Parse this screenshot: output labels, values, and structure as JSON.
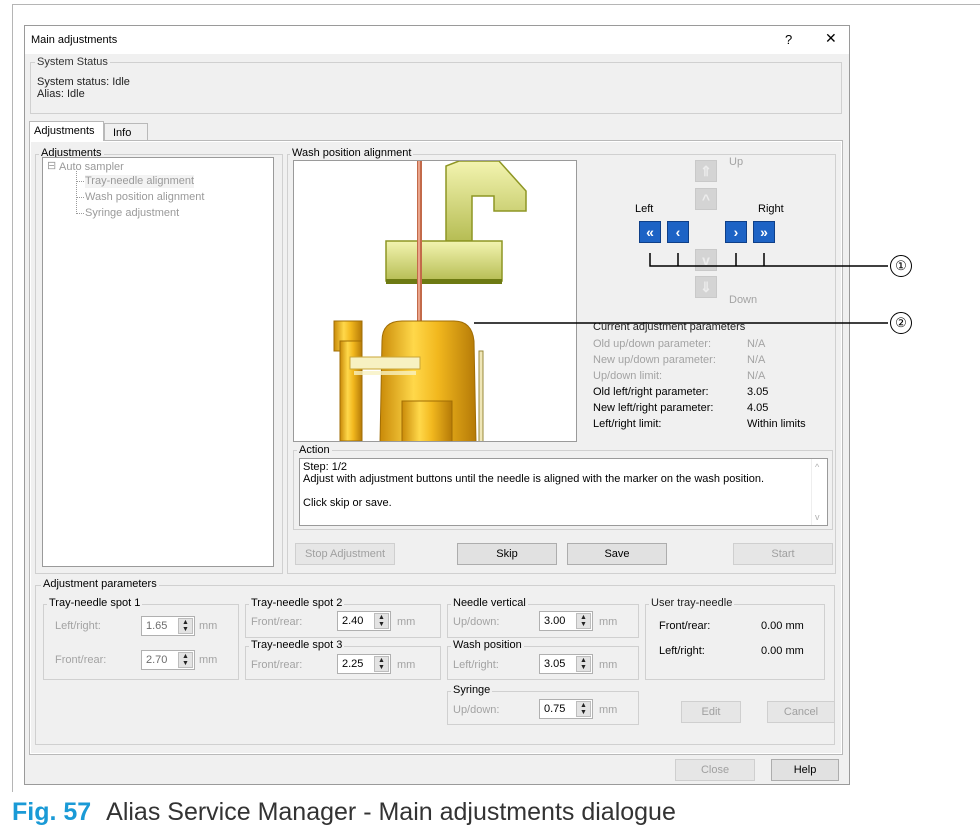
{
  "window": {
    "title": "Main adjustments",
    "help": "?",
    "close": "✕"
  },
  "system_status": {
    "group": "System Status",
    "status": "System status: Idle",
    "alias": "Alias: Idle"
  },
  "tabs": [
    "Adjustments",
    "Info"
  ],
  "adjustments_tree": {
    "group": "Adjustments",
    "root": "Auto sampler",
    "root_toggle": "⊟",
    "children": [
      "Tray-needle alignment",
      "Wash position alignment",
      "Syringe adjustment"
    ]
  },
  "wash": {
    "group": "Wash position alignment",
    "up": "Up",
    "down": "Down",
    "left": "Left",
    "right": "Right",
    "callouts": [
      "①",
      "②"
    ]
  },
  "params": {
    "title": "Current adjustment parameters",
    "rows": [
      {
        "label": "Old up/down parameter:",
        "value": "N/A",
        "enabled": false
      },
      {
        "label": "New up/down parameter:",
        "value": "N/A",
        "enabled": false
      },
      {
        "label": "Up/down limit:",
        "value": "N/A",
        "enabled": false
      },
      {
        "label": "Old left/right parameter:",
        "value": "3.05",
        "enabled": true
      },
      {
        "label": "New left/right parameter:",
        "value": "4.05",
        "enabled": true
      },
      {
        "label": "Left/right limit:",
        "value": "Within limits",
        "enabled": true
      }
    ]
  },
  "action": {
    "group": "Action",
    "step": "Step: 1/2",
    "text": "Adjust with adjustment buttons until the needle is aligned with the marker on the wash position.",
    "hint": "Click skip or save."
  },
  "buttons": {
    "stop": "Stop Adjustment",
    "skip": "Skip",
    "save": "Save",
    "start": "Start",
    "edit": "Edit",
    "cancel": "Cancel",
    "close": "Close",
    "help": "Help"
  },
  "adj_params": {
    "group": "Adjustment parameters",
    "spot1": {
      "title": "Tray-needle spot 1",
      "lr_label": "Left/right:",
      "lr": "1.65",
      "fr_label": "Front/rear:",
      "fr": "2.70"
    },
    "spot2": {
      "title": "Tray-needle spot  2",
      "fr_label": "Front/rear:",
      "fr": "2.40"
    },
    "spot3": {
      "title": "Tray-needle spot 3",
      "fr_label": "Front/rear:",
      "fr": "2.25"
    },
    "needle_vertical": {
      "title": "Needle vertical",
      "label": "Up/down:",
      "value": "3.00"
    },
    "wash_position": {
      "title": "Wash position",
      "label": "Left/right:",
      "value": "3.05"
    },
    "syringe": {
      "title": "Syringe",
      "label": "Up/down:",
      "value": "0.75"
    },
    "unit": "mm",
    "user_tray": {
      "title": "User tray-needle",
      "fr_label": "Front/rear:",
      "fr": "0.00 mm",
      "lr_label": "Left/right:",
      "lr": "0.00 mm"
    }
  },
  "caption": {
    "number": "Fig. 57",
    "text": "Alias Service Manager - Main adjustments dialogue",
    "color": "#1a9ad6"
  }
}
